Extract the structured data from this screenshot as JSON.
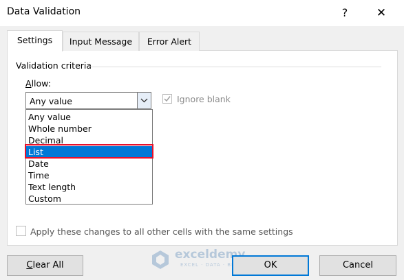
{
  "dialog": {
    "title": "Data Validation",
    "help": "?",
    "close": "✕"
  },
  "tabs": [
    {
      "label": "Settings",
      "active": true
    },
    {
      "label": "Input Message",
      "active": false
    },
    {
      "label": "Error Alert",
      "active": false
    }
  ],
  "criteria": {
    "section_label": "Validation criteria",
    "allow_label": "Allow:",
    "allow_accel": "A",
    "allow_rest": "llow:",
    "allow_value": "Any value",
    "ignore_blank_label": "Ignore blank",
    "ignore_blank_checked": true,
    "options": [
      "Any value",
      "Whole number",
      "Decimal",
      "List",
      "Date",
      "Time",
      "Text length",
      "Custom"
    ],
    "selected_option": "List"
  },
  "apply_all": {
    "label": "Apply these changes to all other cells with the same settings",
    "checked": false
  },
  "buttons": {
    "clear_all": "Clear All",
    "clear_accel": "C",
    "clear_rest": "lear All",
    "ok": "OK",
    "cancel": "Cancel"
  },
  "watermark": {
    "name": "exceldemy",
    "tagline": "EXCEL · DATA · BI"
  },
  "colors": {
    "selection": "#0078d7",
    "highlight_border": "#e8102a",
    "default_button_border": "#0078d7"
  }
}
